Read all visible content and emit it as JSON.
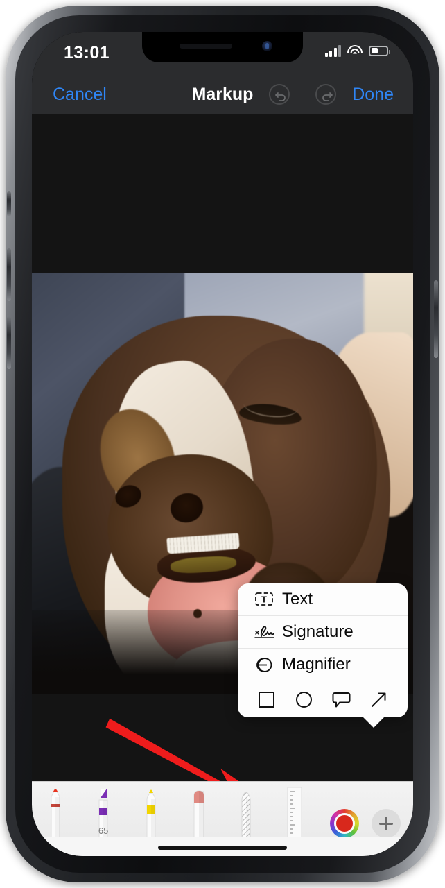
{
  "status_bar": {
    "time": "13:01",
    "cellular_icon": "signal-bars-icon",
    "wifi_icon": "wifi-icon",
    "battery_icon": "battery-icon",
    "battery_level_pct": 42
  },
  "nav_bar": {
    "cancel_label": "Cancel",
    "title": "Markup",
    "done_label": "Done",
    "undo_icon": "undo-arrow-icon",
    "redo_icon": "redo-arrow-icon",
    "undo_enabled": false,
    "redo_enabled": false,
    "accent_color": "#2f86f6",
    "bar_color": "#2b2c2e"
  },
  "canvas": {
    "background_color": "#141414",
    "photo_description": "Close-up photo of a brown and white dog's face resting on a blanket"
  },
  "annotation": {
    "arrow_color": "#ef1c1c",
    "points_to": "shape-tools-row"
  },
  "popup_menu": {
    "background_color": "#fdfdfd",
    "items": [
      {
        "label": "Text",
        "icon": "text-box-icon"
      },
      {
        "label": "Signature",
        "icon": "signature-icon"
      },
      {
        "label": "Magnifier",
        "icon": "magnifier-icon"
      }
    ],
    "shapes": [
      {
        "name": "square-shape",
        "icon": "square-icon"
      },
      {
        "name": "circle-shape",
        "icon": "circle-icon"
      },
      {
        "name": "speech-bubble-shape",
        "icon": "speech-bubble-icon"
      },
      {
        "name": "arrow-shape",
        "icon": "arrow-icon"
      }
    ]
  },
  "toolbar": {
    "background_color": "#ebebeb",
    "tools": [
      {
        "name": "pen",
        "color": "#d8281c",
        "label": ""
      },
      {
        "name": "highlighter",
        "color": "#7b2fb5",
        "label": "65"
      },
      {
        "name": "pencil",
        "color": "#f2d500",
        "label": ""
      },
      {
        "name": "eraser",
        "color": "#e08a82",
        "label": ""
      },
      {
        "name": "lasso",
        "color": "#c9c9c9",
        "label": ""
      },
      {
        "name": "ruler",
        "color": "#d0d0d0",
        "label": ""
      }
    ],
    "color_picker": {
      "icon": "color-wheel-icon",
      "selected_color": "#d8281c"
    },
    "add_button": {
      "icon": "plus-icon"
    }
  },
  "home_indicator": {
    "color": "#121212"
  }
}
